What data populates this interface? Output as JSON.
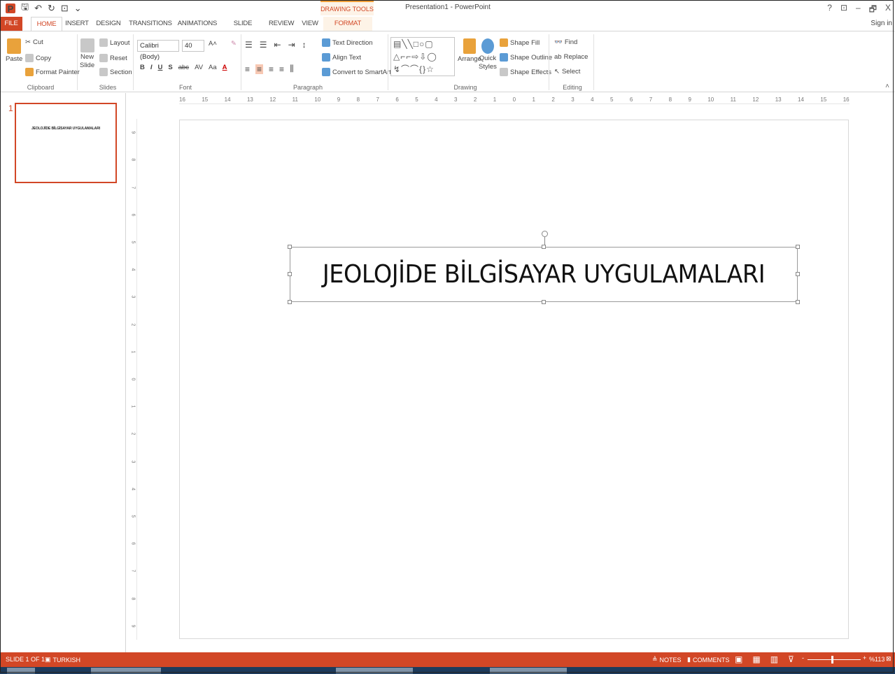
{
  "title_bar": {
    "contextual_tab_group": "DRAWING TOOLS",
    "window_title": "Presentation1 - PowerPoint",
    "controls": [
      "?",
      "⊡",
      "–",
      "🗗",
      "X"
    ],
    "sign_in": "Sign in"
  },
  "tabs": [
    "FILE",
    "HOME",
    "INSERT",
    "DESIGN",
    "TRANSITIONS",
    "ANIMATIONS",
    "SLIDE SHOW",
    "REVIEW",
    "VIEW",
    "FORMAT"
  ],
  "ribbon": {
    "clipboard": {
      "label": "Clipboard",
      "paste": "Paste",
      "cut": "Cut",
      "copy": "Copy",
      "format_painter": "Format Painter"
    },
    "slides": {
      "label": "Slides",
      "new_slide": "New",
      "new_slide_2": "Slide",
      "layout": "Layout",
      "reset": "Reset",
      "section": "Section"
    },
    "font": {
      "label": "Font",
      "font_name": "Calibri (Body)",
      "font_size": "40",
      "bold": "B",
      "italic": "I",
      "underline": "U",
      "shadow": "S",
      "strike": "abc",
      "spacing": "AV",
      "case": "Aa",
      "color": "A"
    },
    "paragraph": {
      "label": "Paragraph",
      "text_direction": "Text Direction",
      "align_text": "Align Text",
      "convert_smartart": "Convert to SmartArt"
    },
    "drawing": {
      "label": "Drawing",
      "arrange": "Arrange",
      "quick_styles": "Quick",
      "quick_styles_2": "Styles",
      "shape_fill": "Shape Fill",
      "shape_outline": "Shape Outline",
      "shape_effects": "Shape Effects"
    },
    "editing": {
      "label": "Editing",
      "find": "Find",
      "replace": "Replace",
      "select": "Select"
    }
  },
  "ruler": {
    "horizontal": [
      "16",
      "15",
      "14",
      "13",
      "12",
      "11",
      "10",
      "9",
      "8",
      "7",
      "6",
      "5",
      "4",
      "3",
      "2",
      "1",
      "0",
      "1",
      "2",
      "3",
      "4",
      "5",
      "6",
      "7",
      "8",
      "9",
      "10",
      "11",
      "12",
      "13",
      "14",
      "15",
      "16"
    ],
    "vertical": [
      "9",
      "8",
      "7",
      "6",
      "5",
      "4",
      "3",
      "2",
      "1",
      "0",
      "1",
      "2",
      "3",
      "4",
      "5",
      "6",
      "7",
      "8",
      "9"
    ]
  },
  "thumbnail": {
    "number": "1",
    "text": "JEOLOJİDE BİLGİSAYAR UYGULAMALARI"
  },
  "slide": {
    "title": "JEOLOJİDE BİLGİSAYAR UYGULAMALARI"
  },
  "status_bar": {
    "slide_info": "SLIDE 1 OF 1",
    "language": "TURKISH",
    "notes": "NOTES",
    "comments": "COMMENTS",
    "zoom": "%113"
  },
  "colors": {
    "accent": "#d24726",
    "contextual_bg": "#fdf3e7"
  }
}
